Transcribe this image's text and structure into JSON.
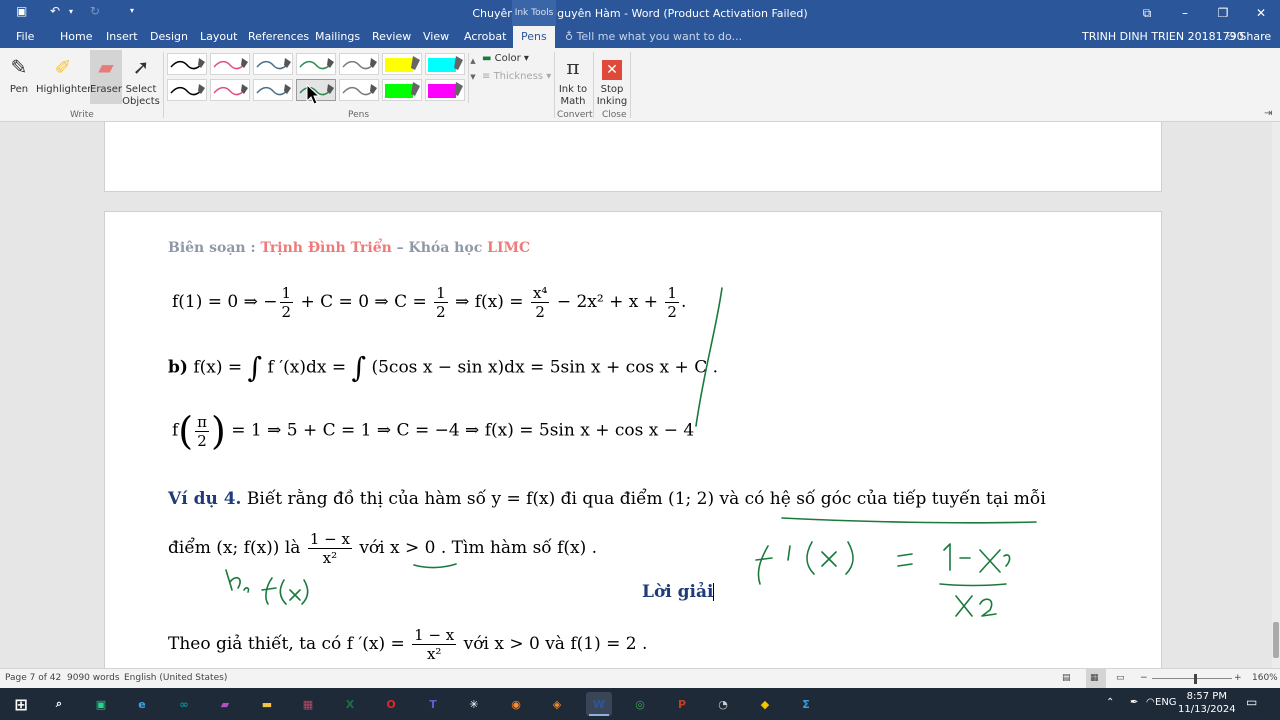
{
  "titlebar": {
    "title": "Chuyên đề 1. Nguyên Hàm - Word (Product Activation Failed)",
    "context_tab": "Ink Tools",
    "save_icon": "save-icon",
    "undo_icon": "undo-icon",
    "redo_icon": "redo-icon",
    "customize_icon": "customize-qat-icon",
    "ribbon_display_icon": "ribbon-display-icon",
    "minimize_icon": "minimize-icon",
    "restore_icon": "restore-icon",
    "close_icon": "close-icon"
  },
  "tabs": [
    {
      "label": "File"
    },
    {
      "label": "Home"
    },
    {
      "label": "Insert"
    },
    {
      "label": "Design"
    },
    {
      "label": "Layout"
    },
    {
      "label": "References"
    },
    {
      "label": "Mailings"
    },
    {
      "label": "Review"
    },
    {
      "label": "View"
    },
    {
      "label": "Acrobat"
    },
    {
      "label": "Pens"
    }
  ],
  "tell_me": "Tell me what you want to do...",
  "user": "TRINH DINH TRIEN 20181790",
  "share": "Share",
  "ribbon": {
    "write": {
      "label": "Write",
      "pen": "Pen",
      "highlighter": "Highlighter",
      "eraser": "Eraser",
      "select": "Select",
      "objects": "Objects"
    },
    "pens": {
      "label": "Pens",
      "color": "Color",
      "thickness": "Thickness",
      "swatches_row1": [
        "#000000",
        "#e0507a",
        "#4a6f8a",
        "#2d8a52",
        "#7a7a7a",
        "#ffff00",
        "#00ffff"
      ],
      "swatches_row2": [
        "#000000",
        "#e0507a",
        "#4a6f8a",
        "#2d8a52",
        "#7a7a7a",
        "#00ff00",
        "#ff00ff"
      ]
    },
    "convert": {
      "label": "Convert",
      "ink": "Ink to",
      "math": "Math"
    },
    "close": {
      "label": "Close",
      "stop": "Stop",
      "inking": "Inking"
    }
  },
  "document": {
    "header": {
      "prefix": "Biên soạn : ",
      "author": "Trịnh Đình Triển",
      "dash": " – Khóa học ",
      "course": "LIMC"
    },
    "line1": {
      "a": "f(1) = 0 ⇒ −",
      "f1n": "1",
      "f1d": "2",
      "b": " + C = 0 ⇒ C = ",
      "f2n": "1",
      "f2d": "2",
      "c": " ⇒ f(x) = ",
      "f3n": "x⁴",
      "f3d": "2",
      "d": " − 2x² + x + ",
      "f4n": "1",
      "f4d": "2",
      "e": "."
    },
    "line2": {
      "label": "b)",
      "a": " f(x) = ",
      "int1": "∫",
      "b": " f ′(x)dx = ",
      "int2": "∫",
      "c": " (5cos x − sin x)dx = 5sin x + cos x + C ."
    },
    "line3": {
      "a": "f",
      "lp": "(",
      "fn": "π",
      "fd": "2",
      "rp": ")",
      "b": " = 1 ⇒ 5 + C = 1 ⇒ C = −4 ⇒ f(x) = 5sin x + cos x − 4"
    },
    "example": {
      "label": "Ví dụ 4.",
      "text": " Biết rằng đồ thị của hàm số  y = f(x)  đi qua điểm  (1; 2)  và có hệ số góc của tiếp tuyến tại mỗi",
      "line2a": "điểm  (x; f(x))  là ",
      "fn": "1 − x",
      "fd": "x²",
      "line2b": "  với  x > 0 . Tìm hàm số  f(x) ."
    },
    "solution_title": "Lời giải",
    "line4": {
      "a": "Theo giả thiết, ta có  f ′(x) = ",
      "fn": "1 − x",
      "fd": "x²",
      "b": "  với  x > 0  và  f(1) = 2 ."
    }
  },
  "status": {
    "page": "Page 7 of 42",
    "words": "9090 words",
    "language": "English (United States)",
    "zoom_minus": "−",
    "zoom_plus": "+",
    "zoom": "160%"
  },
  "taskbar": {
    "lang": "ENG",
    "time": "8:57 PM",
    "date": "11/13/2024",
    "apps": [
      {
        "name": "search-icon",
        "glyph": "⌕",
        "color": "#ffffff"
      },
      {
        "name": "pycharm-icon",
        "glyph": "▣",
        "color": "#21d789"
      },
      {
        "name": "edge-icon",
        "glyph": "e",
        "color": "#3ba4e8"
      },
      {
        "name": "arduino-icon",
        "glyph": "∞",
        "color": "#00979c"
      },
      {
        "name": "media-icon",
        "glyph": "▰",
        "color": "#b44fc6"
      },
      {
        "name": "file-explorer-icon",
        "glyph": "▬",
        "color": "#f4c542"
      },
      {
        "name": "winrar-icon",
        "glyph": "▦",
        "color": "#b34a6a"
      },
      {
        "name": "excel-icon",
        "glyph": "X",
        "color": "#1d7044"
      },
      {
        "name": "opera-icon",
        "glyph": "O",
        "color": "#e0262f"
      },
      {
        "name": "teams-icon",
        "glyph": "T",
        "color": "#5b5fc7"
      },
      {
        "name": "settings-icon",
        "glyph": "✳",
        "color": "#ffffff"
      },
      {
        "name": "firefox-icon",
        "glyph": "◉",
        "color": "#ff8a2b"
      },
      {
        "name": "app-orange-icon",
        "glyph": "◈",
        "color": "#f08c2a"
      },
      {
        "name": "word-icon",
        "glyph": "W",
        "color": "#2b579a"
      },
      {
        "name": "chrome-icon",
        "glyph": "◎",
        "color": "#34a853"
      },
      {
        "name": "powerpoint-icon",
        "glyph": "P",
        "color": "#c43e1c"
      },
      {
        "name": "app-dark-icon",
        "glyph": "◔",
        "color": "#cccccc"
      },
      {
        "name": "app-yellow-icon",
        "glyph": "◆",
        "color": "#f5c400"
      },
      {
        "name": "sigma-icon",
        "glyph": "Σ",
        "color": "#3aa0e0"
      }
    ]
  },
  "colors": {
    "accent": "#2b579a",
    "ink": "#1a7a3c",
    "header_red": "#ef7a7a",
    "header_gray": "#8e98a8"
  }
}
